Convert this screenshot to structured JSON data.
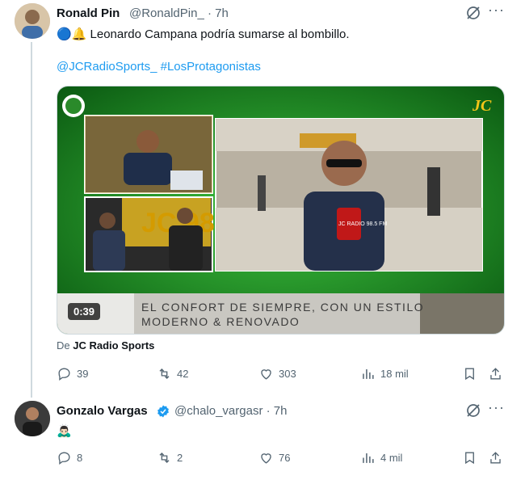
{
  "tweets": [
    {
      "author": "Ronald Pin",
      "handle": "@RonaldPin_",
      "time": "· 7h",
      "text": "Leonardo Campana podría sumarse al bombillo.",
      "emoji": "🔵🔔",
      "links": "@JCRadioSports_ #LosProtagonistas",
      "media": {
        "duration": "0:39",
        "banner_line1": "EL CONFORT DE SIEMPRE, CON UN ESTILO",
        "banner_line2": "MODERNO & RENOVADO",
        "logo_text": "JC",
        "mic_text": "JC RADIO 98.5 FM",
        "studio_text": "JC 98.5"
      },
      "source_prefix": "De",
      "source_name": "JC Radio Sports",
      "stats": {
        "replies": "39",
        "reposts": "42",
        "likes": "303",
        "views": "18 mil"
      }
    },
    {
      "author": "Gonzalo Vargas",
      "handle": "@chalo_vargasr",
      "time": "· 7h",
      "emoji": "🙇🏻‍♂️",
      "stats": {
        "replies": "8",
        "reposts": "2",
        "likes": "76",
        "views": "4 mil"
      }
    }
  ],
  "icons": {
    "grok": "grok-icon",
    "more": "more-icon",
    "reply": "reply-icon",
    "repost": "repost-icon",
    "like": "like-icon",
    "views": "views-icon",
    "bookmark": "bookmark-icon",
    "share": "share-icon",
    "verified": "verified-badge-icon"
  },
  "colors": {
    "link": "#1d9bf0",
    "verified": "#1d9bf0",
    "secondary": "#536471",
    "media_green": "#1e8a1e"
  }
}
